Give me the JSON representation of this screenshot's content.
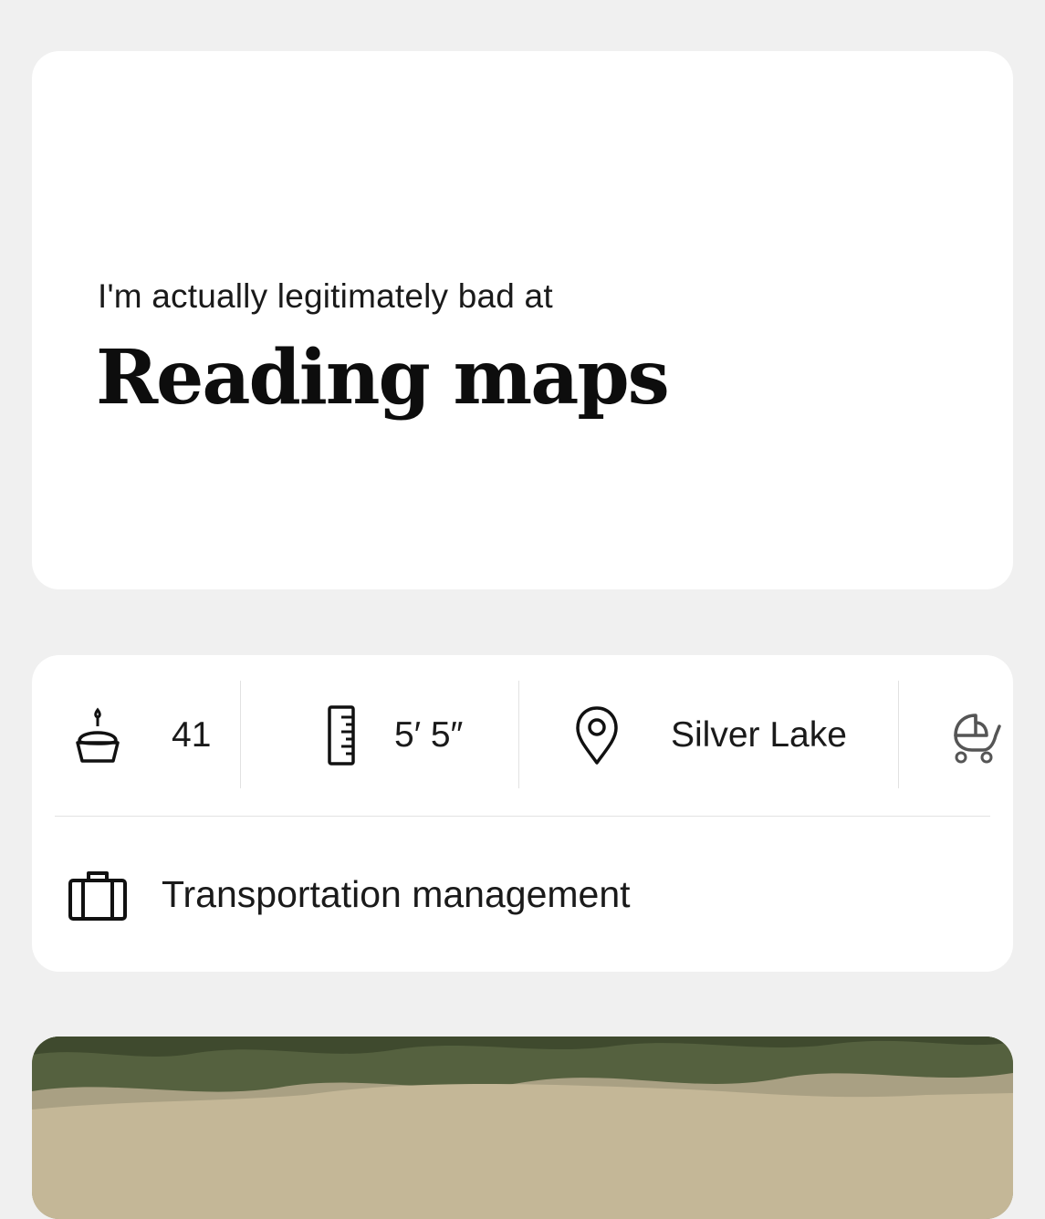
{
  "prompt": {
    "label": "I'm actually legitimately bad at",
    "answer": "Reading maps"
  },
  "vitals": {
    "age": "41",
    "height": "5′ 5″",
    "location": "Silver Lake"
  },
  "work": {
    "job": "Transportation management"
  },
  "icons": {
    "age": "birthday-cake-icon",
    "height": "ruler-icon",
    "location": "location-pin-icon",
    "children": "stroller-icon",
    "job": "briefcase-icon"
  }
}
